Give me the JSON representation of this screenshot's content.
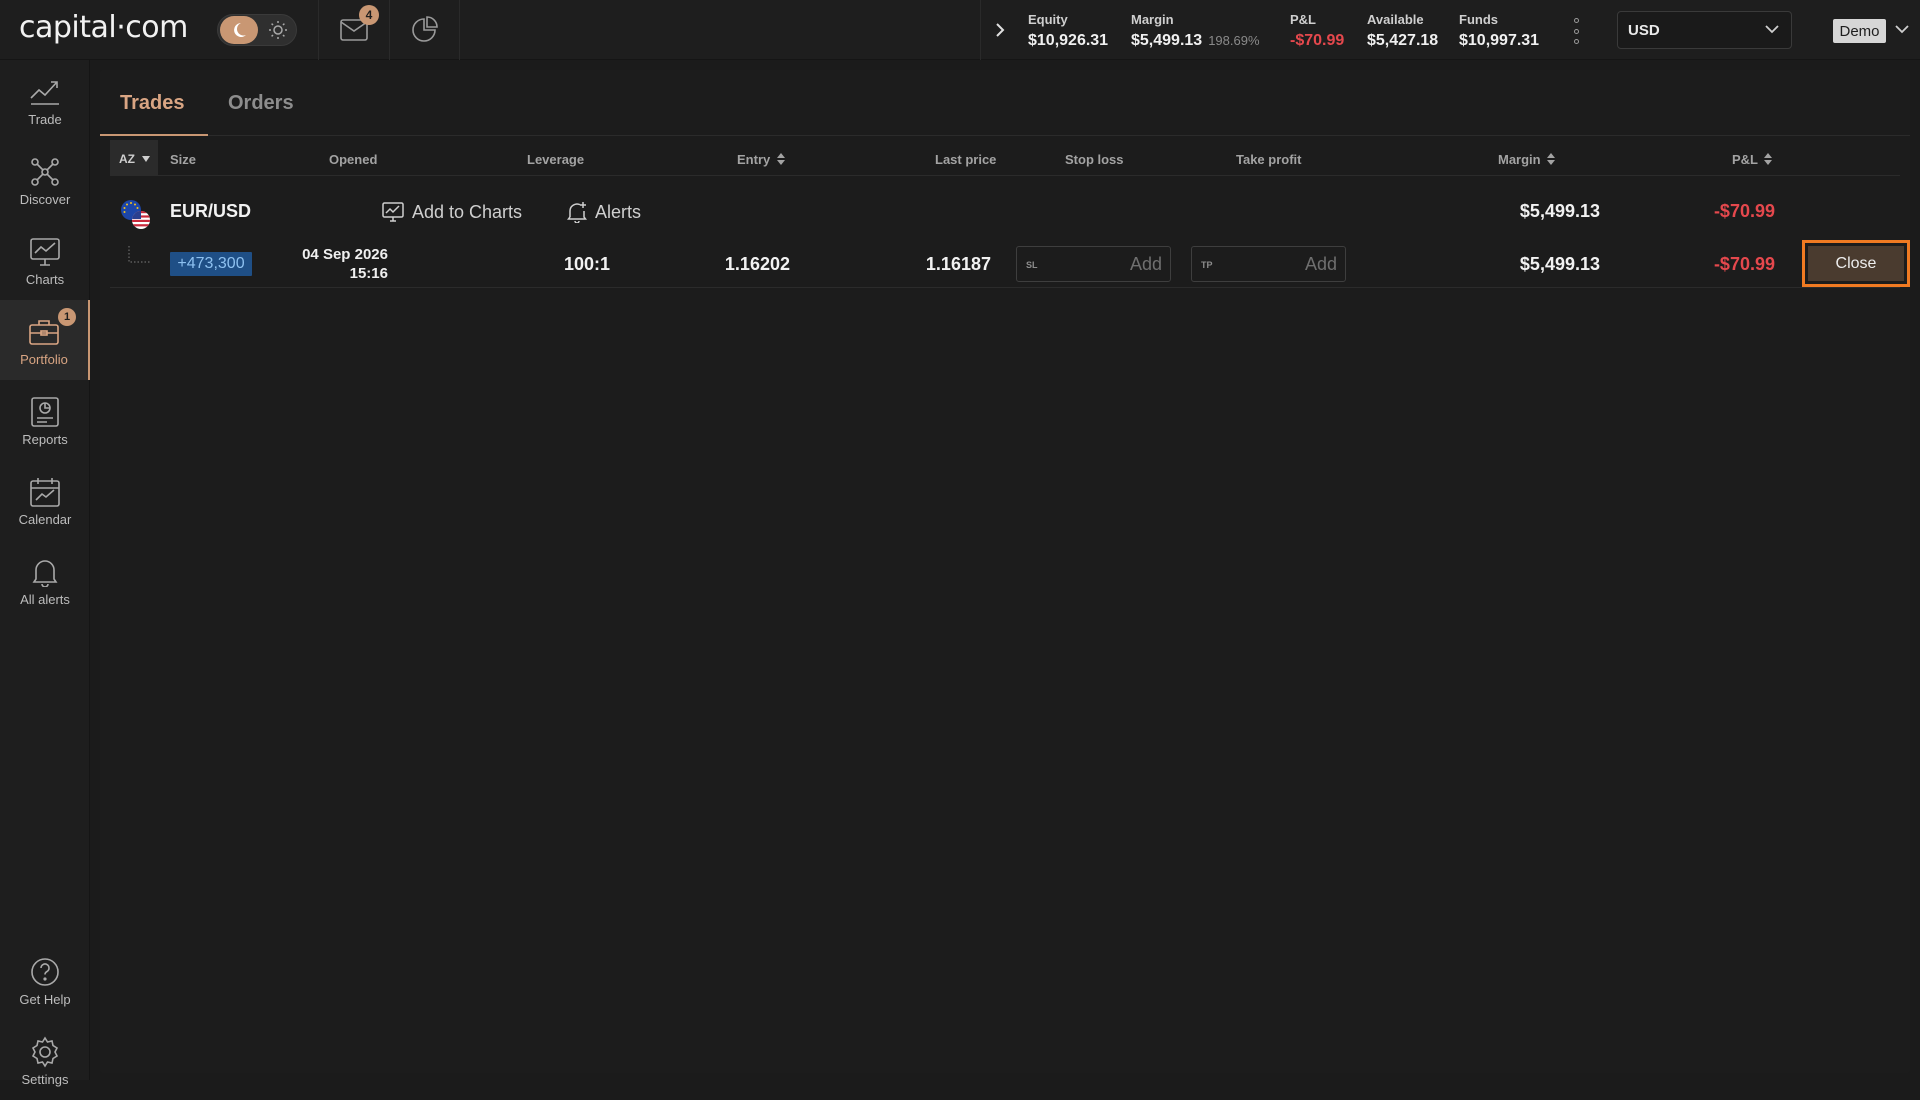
{
  "brand": {
    "logo_text": "capital·com"
  },
  "header": {
    "mail_badge": "4",
    "stats": [
      {
        "label": "Equity",
        "value": "$10,926.31"
      },
      {
        "label": "Margin",
        "value": "$5,499.13",
        "extra": "198.69%"
      },
      {
        "label": "P&L",
        "value": "-$70.99"
      },
      {
        "label": "Available",
        "value": "$5,427.18"
      },
      {
        "label": "Funds",
        "value": "$10,997.31"
      }
    ],
    "currency": "USD",
    "account_type": "Demo"
  },
  "sidebar": {
    "items": [
      {
        "label": "Trade",
        "icon": "trade-chart-icon"
      },
      {
        "label": "Discover",
        "icon": "network-icon"
      },
      {
        "label": "Charts",
        "icon": "monitor-chart-icon"
      },
      {
        "label": "Portfolio",
        "icon": "briefcase-icon",
        "badge": "1",
        "active": true
      },
      {
        "label": "Reports",
        "icon": "report-icon"
      },
      {
        "label": "Calendar",
        "icon": "calendar-icon"
      },
      {
        "label": "All alerts",
        "icon": "bell-icon"
      },
      {
        "label": "Get Help",
        "icon": "help-icon"
      },
      {
        "label": "Settings",
        "icon": "gear-icon"
      }
    ]
  },
  "tabs": [
    {
      "label": "Trades",
      "active": true
    },
    {
      "label": "Orders",
      "active": false
    }
  ],
  "table": {
    "sort_label": "AZ",
    "columns": {
      "size": "Size",
      "opened": "Opened",
      "leverage": "Leverage",
      "entry": "Entry",
      "last_price": "Last price",
      "stop_loss": "Stop loss",
      "take_profit": "Take profit",
      "margin": "Margin",
      "pnl": "P&L"
    },
    "group": {
      "instrument": "EUR/USD",
      "add_to_charts": "Add to Charts",
      "alerts": "Alerts",
      "margin": "$5,499.13",
      "pnl": "-$70.99"
    },
    "trade": {
      "size": "+473,300",
      "opened_date": "04 Sep 2026",
      "opened_time": "15:16",
      "leverage": "100:1",
      "entry": "1.16202",
      "last_price": "1.16187",
      "sl_placeholder": "SL",
      "tp_placeholder": "TP",
      "add_label": "Add",
      "margin": "$5,499.13",
      "pnl": "-$70.99",
      "close_label": "Close"
    }
  },
  "colors": {
    "accent": "#c99773",
    "negative": "#e5484d",
    "highlight_border": "#f07a22",
    "size_pill": "#1f4f86"
  }
}
